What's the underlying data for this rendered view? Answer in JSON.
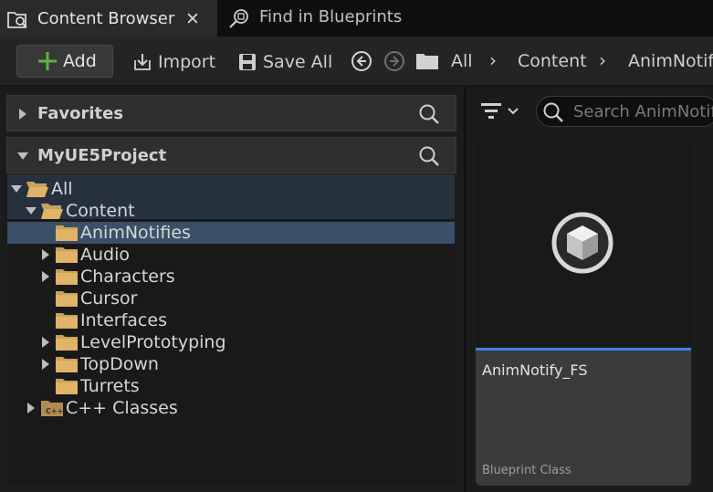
{
  "tabs": [
    {
      "label": "Content Browser",
      "icon": "content-browser-icon",
      "active": true,
      "close": "✕"
    },
    {
      "label": "Find in Blueprints",
      "icon": "find-blueprints-icon",
      "active": false
    }
  ],
  "toolbar": {
    "add_label": "Add",
    "import_label": "Import",
    "save_all_label": "Save All",
    "breadcrumb": [
      "All",
      "Content",
      "AnimNotifies"
    ],
    "accent_color": "#5fb33f"
  },
  "left_panel": {
    "favorites_label": "Favorites",
    "project_label": "MyUE5Project",
    "tree": [
      {
        "label": "All",
        "depth": 0,
        "expanded": true,
        "selected": false
      },
      {
        "label": "Content",
        "depth": 1,
        "expanded": true,
        "selected": false
      },
      {
        "label": "AnimNotifies",
        "depth": 2,
        "expanded": null,
        "selected": true
      },
      {
        "label": "Audio",
        "depth": 2,
        "expanded": false,
        "selected": false
      },
      {
        "label": "Characters",
        "depth": 2,
        "expanded": false,
        "selected": false
      },
      {
        "label": "Cursor",
        "depth": 2,
        "expanded": null,
        "selected": false
      },
      {
        "label": "Interfaces",
        "depth": 2,
        "expanded": null,
        "selected": false
      },
      {
        "label": "LevelPrototyping",
        "depth": 2,
        "expanded": false,
        "selected": false
      },
      {
        "label": "TopDown",
        "depth": 2,
        "expanded": false,
        "selected": false
      },
      {
        "label": "Turrets",
        "depth": 2,
        "expanded": null,
        "selected": false
      },
      {
        "label": "C++ Classes",
        "depth": 1,
        "expanded": false,
        "selected": false,
        "icon": "cpp-folder-icon"
      }
    ]
  },
  "right_panel": {
    "search_placeholder": "Search AnimNotifies",
    "asset": {
      "name": "AnimNotify_FS",
      "type": "Blueprint Class",
      "accent_color": "#3f83e8"
    }
  }
}
